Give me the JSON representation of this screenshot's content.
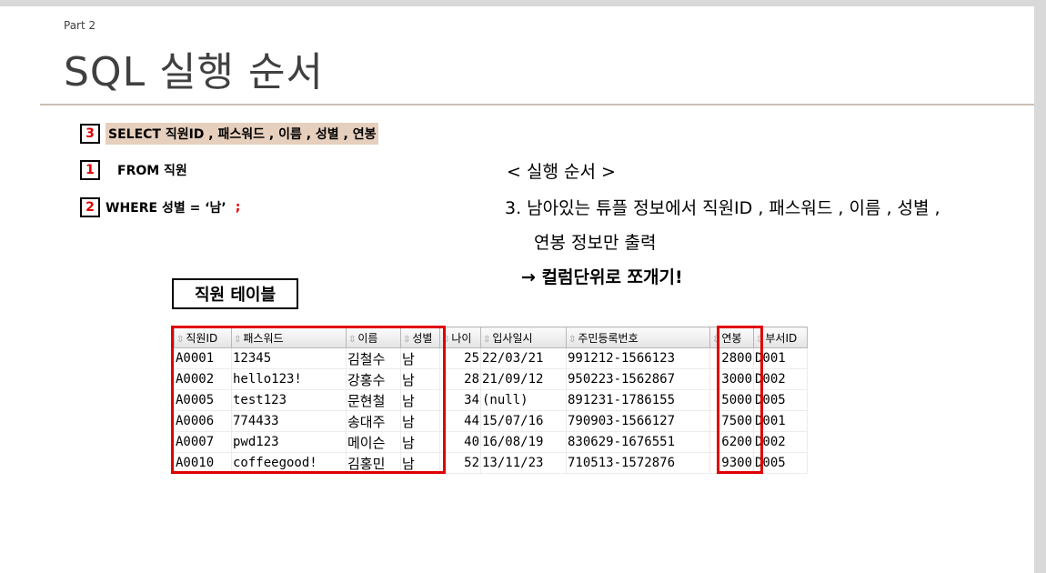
{
  "slide": {
    "part": "Part 2",
    "title": "SQL 실행 순서"
  },
  "steps": [
    {
      "num": "3",
      "clause": "SELECT 직원ID ,  패스워드 , 이름 , 성별 , 연봉"
    },
    {
      "num": "1",
      "clause": "FROM 직원"
    },
    {
      "num": "2",
      "clause": "WHERE 성별 = ‘남’",
      "terminator": ";"
    }
  ],
  "execution": {
    "heading": "< 실행 순서 >",
    "line1": "3. 남아있는 튜플 정보에서 직원ID , 패스워드 , 이름 , 성별 ,",
    "line2": "연봉 정보만 출력",
    "line3": "→ 컬럼단위로 쪼개기!"
  },
  "table": {
    "caption": "직원 테이블",
    "columns": [
      "직원ID",
      "패스워드",
      "이름",
      "성별",
      "나이",
      "입사일시",
      "주민등록번호",
      "연봉",
      "부서ID"
    ],
    "rows": [
      [
        "A0001",
        "12345",
        "김철수",
        "남",
        "25",
        "22/03/21",
        "991212-1566123",
        "2800",
        "D001"
      ],
      [
        "A0002",
        "hello123!",
        "강홍수",
        "남",
        "28",
        "21/09/12",
        "950223-1562867",
        "3000",
        "D002"
      ],
      [
        "A0005",
        "test123",
        "문현철",
        "남",
        "34",
        "(null)",
        "891231-1786155",
        "5000",
        "D005"
      ],
      [
        "A0006",
        "774433",
        "송대주",
        "남",
        "44",
        "15/07/16",
        "790903-1566127",
        "7500",
        "D001"
      ],
      [
        "A0007",
        "pwd123",
        "메이슨",
        "남",
        "40",
        "16/08/19",
        "830629-1676551",
        "6200",
        "D002"
      ],
      [
        "A0010",
        "coffeegood!",
        "김홍민",
        "남",
        "52",
        "13/11/23",
        "710513-1572876",
        "9300",
        "D005"
      ]
    ],
    "highlight_color": "#e00000"
  }
}
